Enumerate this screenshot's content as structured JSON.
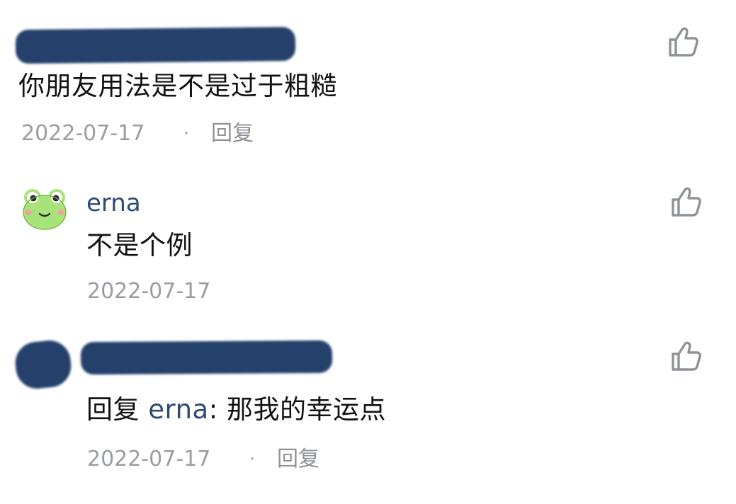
{
  "comments": [
    {
      "text": "你朋友用法是不是过于粗糙",
      "date": "2022-07-17",
      "reply_label": "回复"
    },
    {
      "username": "erna",
      "text": "不是个例",
      "date": "2022-07-17"
    },
    {
      "reply_prefix": "回复",
      "mention": "erna",
      "text_suffix": ": 那我的幸运点",
      "date": "2022-07-17",
      "reply_label": "回复"
    }
  ],
  "icons": {
    "like": "thumbs-up-icon",
    "avatar": "frog-avatar"
  },
  "colors": {
    "redaction": "#24406b",
    "username": "#2e4a72",
    "meta": "#9a9ca4"
  }
}
